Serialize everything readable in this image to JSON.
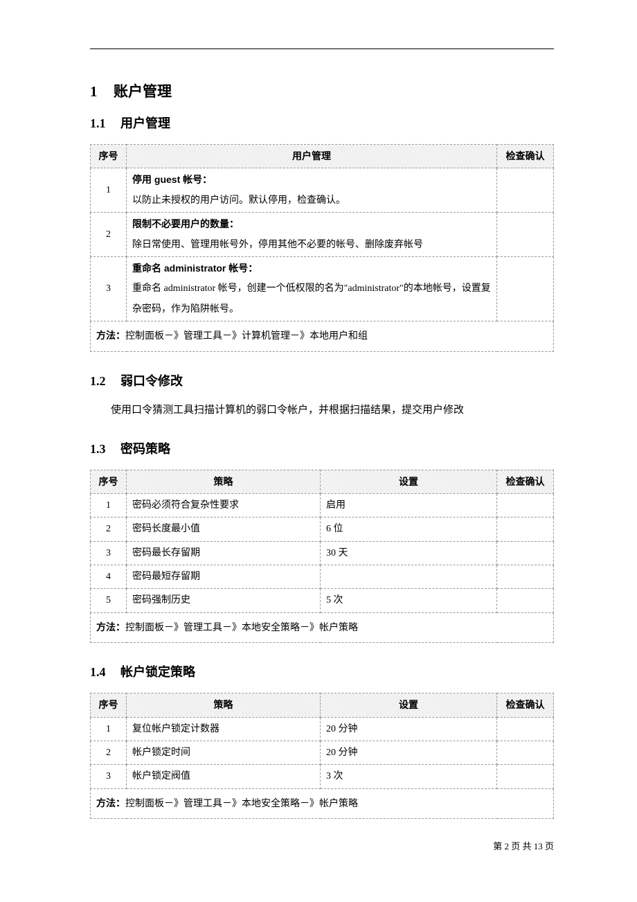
{
  "sections": {
    "s1": {
      "num": "1",
      "title": "账户管理"
    },
    "s1_1": {
      "num": "1.1",
      "title": "用户管理"
    },
    "s1_2": {
      "num": "1.2",
      "title": "弱口令修改",
      "body": "使用口令猜测工具扫描计算机的弱口令帐户，并根据扫描结果，提交用户修改"
    },
    "s1_3": {
      "num": "1.3",
      "title": "密码策略"
    },
    "s1_4": {
      "num": "1.4",
      "title": "帐户锁定策略"
    }
  },
  "t1": {
    "headers": {
      "no": "序号",
      "main": "用户管理",
      "check": "检查确认"
    },
    "rows": [
      {
        "no": "1",
        "title": "停用 guest 帐号：",
        "desc": "以防止未授权的用户访问。默认停用，检查确认。"
      },
      {
        "no": "2",
        "title": "限制不必要用户的数量：",
        "desc": "除日常使用、管理用帐号外，停用其他不必要的帐号、删除废弃帐号"
      },
      {
        "no": "3",
        "title": "重命名 administrator 帐号：",
        "desc": "重命名 administrator 帐号，创建一个低权限的名为\"administrator\"的本地帐号，设置复杂密码，作为陷阱帐号。"
      }
    ],
    "method_label": "方法：",
    "method": "控制面板－》管理工具－》计算机管理－》本地用户和组"
  },
  "t3": {
    "headers": {
      "no": "序号",
      "policy": "策略",
      "setting": "设置",
      "check": "检查确认"
    },
    "rows": [
      {
        "no": "1",
        "policy": "密码必须符合复杂性要求",
        "setting": "启用"
      },
      {
        "no": "2",
        "policy": "密码长度最小值",
        "setting": "6 位"
      },
      {
        "no": "3",
        "policy": "密码最长存留期",
        "setting": "30 天"
      },
      {
        "no": "4",
        "policy": "密码最短存留期",
        "setting": ""
      },
      {
        "no": "5",
        "policy": "密码强制历史",
        "setting": "5 次"
      }
    ],
    "method_label": "方法：",
    "method": "控制面板－》管理工具－》本地安全策略－》帐户策略"
  },
  "t4": {
    "headers": {
      "no": "序号",
      "policy": "策略",
      "setting": "设置",
      "check": "检查确认"
    },
    "rows": [
      {
        "no": "1",
        "policy": "复位帐户锁定计数器",
        "setting": "20 分钟"
      },
      {
        "no": "2",
        "policy": "帐户锁定时间",
        "setting": "20 分钟"
      },
      {
        "no": "3",
        "policy": "帐户锁定阀值",
        "setting": "3 次"
      }
    ],
    "method_label": "方法：",
    "method": "控制面板－》管理工具－》本地安全策略－》帐户策略"
  },
  "footer": {
    "p1": "第 ",
    "cur": "2",
    "p2": " 页 共 ",
    "total": "13",
    "p3": " 页"
  }
}
